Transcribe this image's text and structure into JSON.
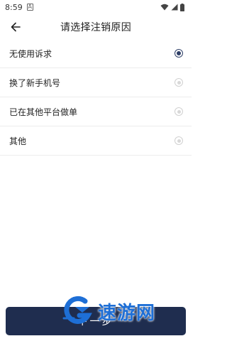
{
  "status_bar": {
    "time": "8:59",
    "notification_glyph": "A"
  },
  "header": {
    "title": "请选择注销原因",
    "back_icon": "arrow-left-icon"
  },
  "reasons": [
    {
      "label": "无使用诉求",
      "selected": true
    },
    {
      "label": "换了新手机号",
      "selected": false
    },
    {
      "label": "已在其他平台做单",
      "selected": false
    },
    {
      "label": "其他",
      "selected": false
    }
  ],
  "footer": {
    "next_label": "下一步"
  },
  "watermark": {
    "text": "速游网"
  },
  "colors": {
    "accent": "#1f2d4f",
    "watermark": "#1e6fd6",
    "divider": "#ececec"
  }
}
